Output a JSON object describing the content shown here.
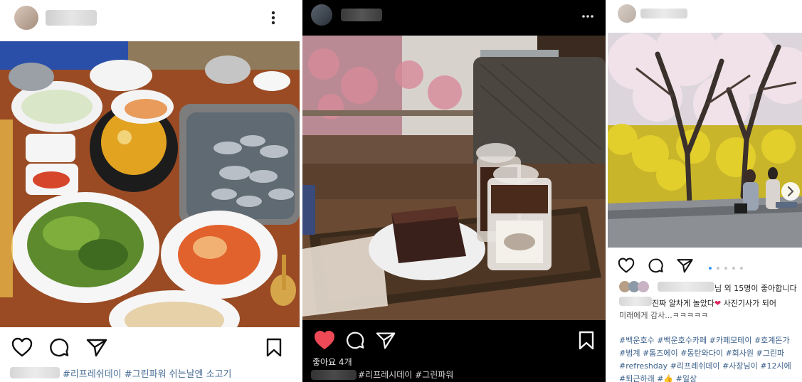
{
  "posts": [
    {
      "likes_text": "",
      "caption_text": "#리프레쉬데이 #그린파워 쉬는날엔 소고기"
    },
    {
      "likes_text": "좋아요 4개",
      "caption_text": "#리프레시데이 #그린파워"
    },
    {
      "likes_text": "님 외 15명이 좋아합니다",
      "comment_line1": "진짜 알차게 놀았다",
      "comment_line1_tail": " 사진기사가 되어",
      "comment_line2": "미래에게 감사...ㅋㅋㅋㅋㅋ",
      "hashtag_lines": [
        "#백운호수 #백운호수카페 #카페모테이 #호계돈가",
        "#범계 #톰즈에이 #동탄와다이 #회사원 #그린파",
        "#refreshday #리프레쉬데이 #사장님이 #12시에",
        "#퇴근하래 #👍 #일상"
      ]
    }
  ],
  "icons": {
    "more": "more-options-icon",
    "like": "heart-icon",
    "comment": "comment-icon",
    "share": "share-icon",
    "save": "bookmark-icon",
    "next": "chevron-right-icon"
  },
  "colors": {
    "liked_heart": "#ed4956",
    "hashtag": "#3a5f8a",
    "pager_active": "#3897f0",
    "dark_panel": "#000000"
  }
}
